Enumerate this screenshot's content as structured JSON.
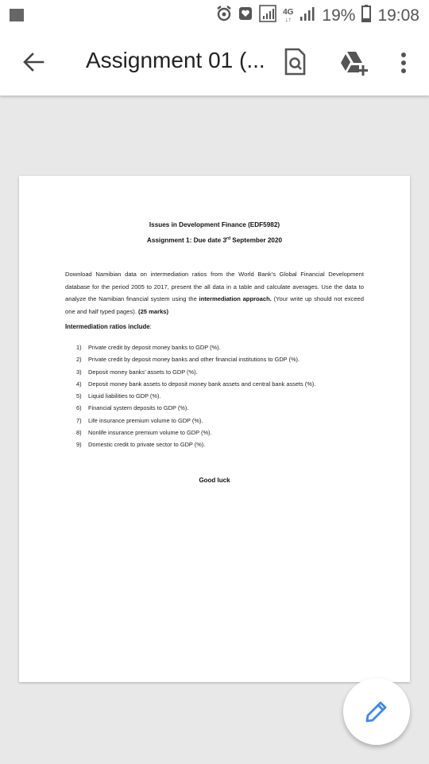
{
  "status_bar": {
    "network_type": "4G",
    "battery_percent": "19%",
    "time": "19:08",
    "icons": [
      "notification-square-icon",
      "alarm-icon",
      "heart-message-icon",
      "signal-icon",
      "signal-bars-icon",
      "battery-icon"
    ]
  },
  "app_bar": {
    "title": "Assignment 01 (...",
    "icons": [
      "arrow-back-icon",
      "search-document-icon",
      "add-to-drive-icon",
      "more-vert-icon"
    ]
  },
  "document": {
    "title": "Issues in Development Finance (EDF5982)",
    "subtitle_before": "Assignment 1: Due date 3",
    "subtitle_sup": "rd",
    "subtitle_after": " September 2020",
    "paragraph_text": "Download Namibian data on intermediation ratios from the World Bank’s Global Financial Development database for the period 2005 to 2017, present the all data in a table and calculate averages. Use the data to analyze the Namibian financial system using the ",
    "paragraph_bold": "intermediation approach.",
    "paragraph_after": " (Your write up should not exceed one and half typed pages). ",
    "paragraph_marks": "(25 marks)",
    "ratios_heading": "Intermediation ratios include",
    "ratios_colon": ":",
    "ratios": [
      {
        "num": "1)",
        "text": "Private credit by deposit money banks to GDP (%)."
      },
      {
        "num": "2)",
        "text": "Private credit by deposit money banks and other financial institutions to GDP (%)."
      },
      {
        "num": "3)",
        "text": "Deposit money banks’ assets to GDP (%)."
      },
      {
        "num": "4)",
        "text": "Deposit money bank assets to deposit money bank assets and central bank assets (%)."
      },
      {
        "num": "5)",
        "text": "Liquid liabilities to GDP (%)."
      },
      {
        "num": "6)",
        "text": "Financial system deposits to GDP (%)."
      },
      {
        "num": "7)",
        "text": "Life insurance premium volume to GDP (%)."
      },
      {
        "num": "8)",
        "text": "Nonlife insurance premium volume to GDP (%)."
      },
      {
        "num": "9)",
        "text": "Domestic credit to private sector to GDP (%)."
      }
    ],
    "closing": "Good luck"
  },
  "fab": {
    "icon": "edit-pencil-icon"
  },
  "colors": {
    "background": "#e8e8e8",
    "accent": "#4285f4",
    "drive_green": "#5f6368"
  }
}
